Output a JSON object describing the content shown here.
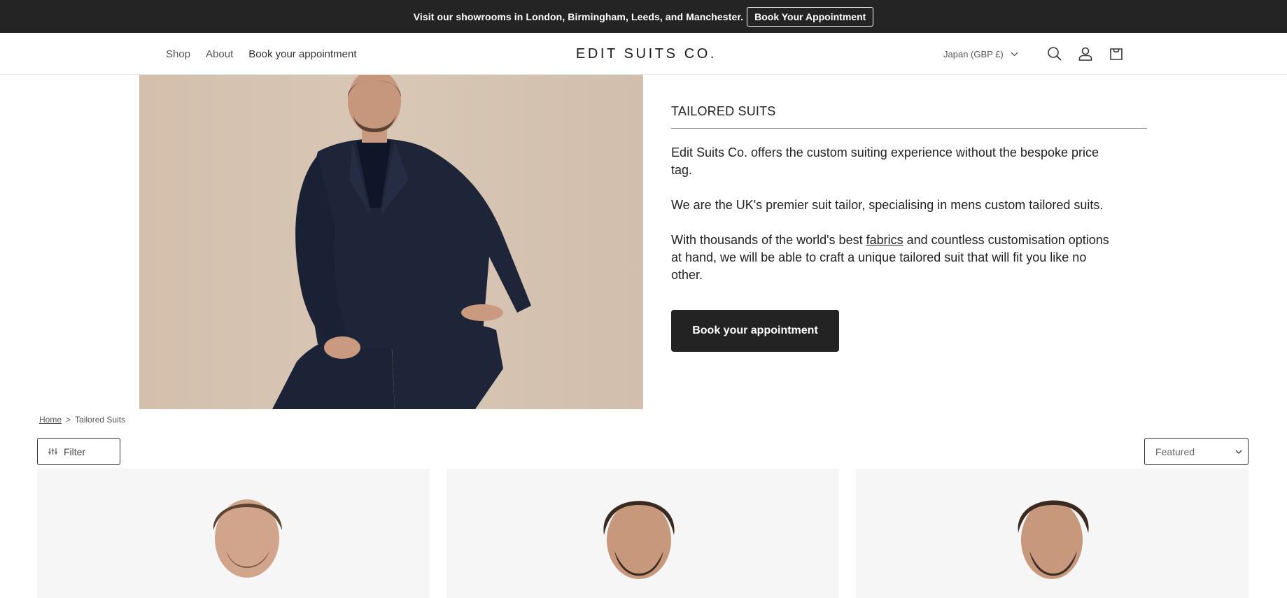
{
  "announcement": {
    "message": "Visit our showrooms in London, Birmingham, Leeds, and Manchester.",
    "button_label": "Book Your Appointment"
  },
  "header": {
    "nav": [
      "Shop",
      "About",
      "Book your appointment"
    ],
    "logo": "EDIT SUITS CO.",
    "country": "Japan (GBP £)",
    "icons": [
      "search-icon",
      "account-icon",
      "cart-icon"
    ]
  },
  "hero": {
    "title": "TAILORED SUITS",
    "p1": "Edit Suits Co. offers the custom suiting experience without the bespoke price tag.",
    "p2": "We are the UK's premier suit tailor, specialising in mens custom tailored suits.",
    "p3_before": "With thousands of the world's best ",
    "p3_link": "fabrics",
    "p3_after": " and countless customisation options at hand, we will be able to craft a unique tailored suit that will fit you like no other.",
    "button_label": "Book your appointment"
  },
  "breadcrumb": {
    "home": "Home",
    "separator": ">",
    "current": "Tailored Suits"
  },
  "toolbar": {
    "filter_label": "Filter",
    "sort_selected": "Featured"
  },
  "colors": {
    "announcement_bg": "#242424",
    "button_bg": "#232323",
    "hero_bg": "#d7c4b2",
    "suit_navy": "#1e2538",
    "product_bg": "#f6f6f6"
  }
}
